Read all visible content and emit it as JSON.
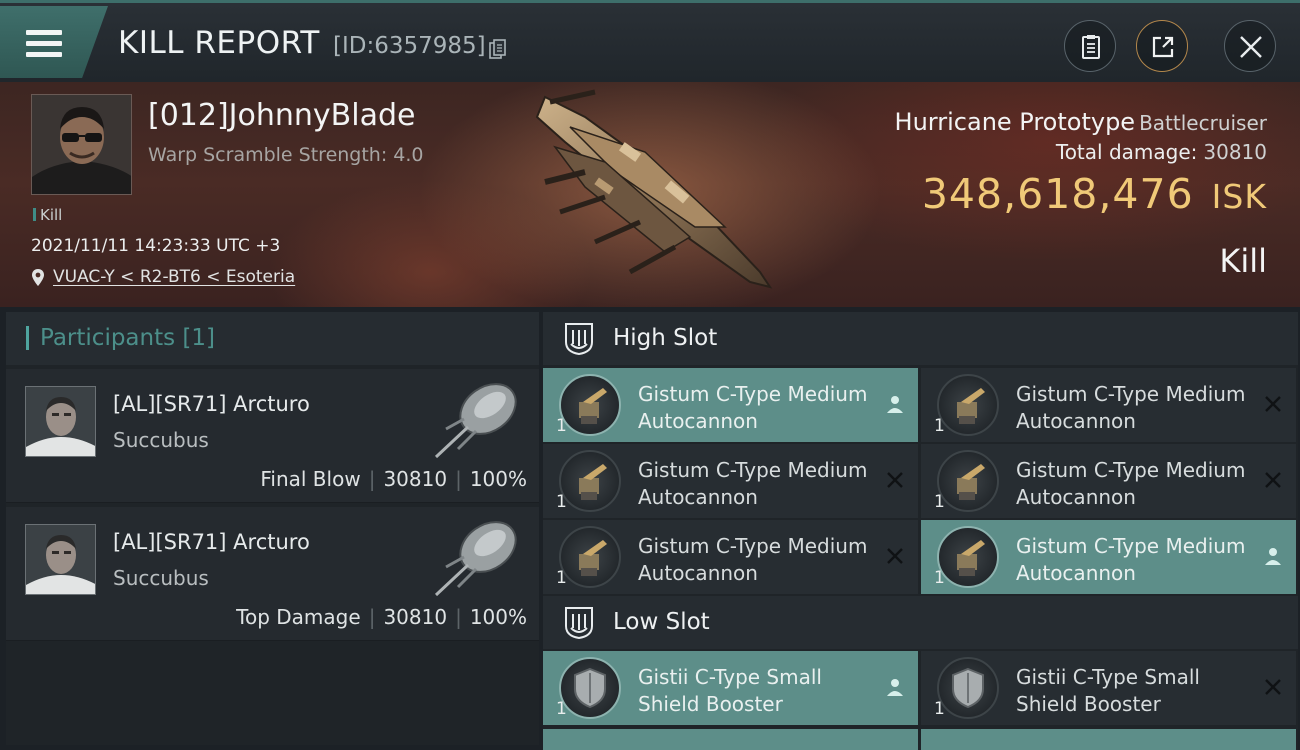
{
  "header": {
    "title": "KILL REPORT",
    "report_id": "[ID:6357985]"
  },
  "victim": {
    "name": "[012]JohnnyBlade",
    "scramble": "Warp Scramble Strength: 4.0",
    "kill_tag": "Kill",
    "timestamp": "2021/11/11 14:23:33 UTC +3",
    "location": "VUAC-Y < R2-BT6 < Esoteria",
    "ship_name": "Hurricane Prototype",
    "ship_class": "Battlecruiser",
    "damage_label": "Total damage:",
    "damage_value": "30810",
    "isk_value": "348,618,476",
    "isk_unit": "ISK",
    "result": "Kill"
  },
  "participants": {
    "label": "Participants",
    "count": "[1]",
    "rows": [
      {
        "name": "[AL][SR71] Arcturo",
        "ship": "Succubus",
        "role": "Final Blow",
        "damage": "30810",
        "percent": "100%"
      },
      {
        "name": "[AL][SR71] Arcturo",
        "ship": "Succubus",
        "role": "Top Damage",
        "damage": "30810",
        "percent": "100%"
      }
    ]
  },
  "slots": {
    "high": {
      "label": "High Slot",
      "modules": [
        {
          "name": "Gistum C-Type Medium Autocannon",
          "qty": "1",
          "state": "person-icon"
        },
        {
          "name": "Gistum C-Type Medium Autocannon",
          "qty": "1",
          "state": "destroyed-x-icon"
        },
        {
          "name": "Gistum C-Type Medium Autocannon",
          "qty": "1",
          "state": "destroyed-x-icon"
        },
        {
          "name": "Gistum C-Type Medium Autocannon",
          "qty": "1",
          "state": "destroyed-x-icon"
        },
        {
          "name": "Gistum C-Type Medium Autocannon",
          "qty": "1",
          "state": "destroyed-x-icon"
        },
        {
          "name": "Gistum C-Type Medium Autocannon",
          "qty": "1",
          "state": "person-icon"
        }
      ]
    },
    "low": {
      "label": "Low Slot",
      "modules": [
        {
          "name": "Gistii C-Type Small Shield Booster",
          "qty": "1",
          "state": "person-icon"
        },
        {
          "name": "Gistii C-Type Small Shield Booster",
          "qty": "1",
          "state": "destroyed-x-icon"
        }
      ]
    }
  },
  "colors": {
    "accent_teal": "#5d8e89",
    "isk_gold": "#f0c978",
    "hero_red": "#4a2b25"
  }
}
